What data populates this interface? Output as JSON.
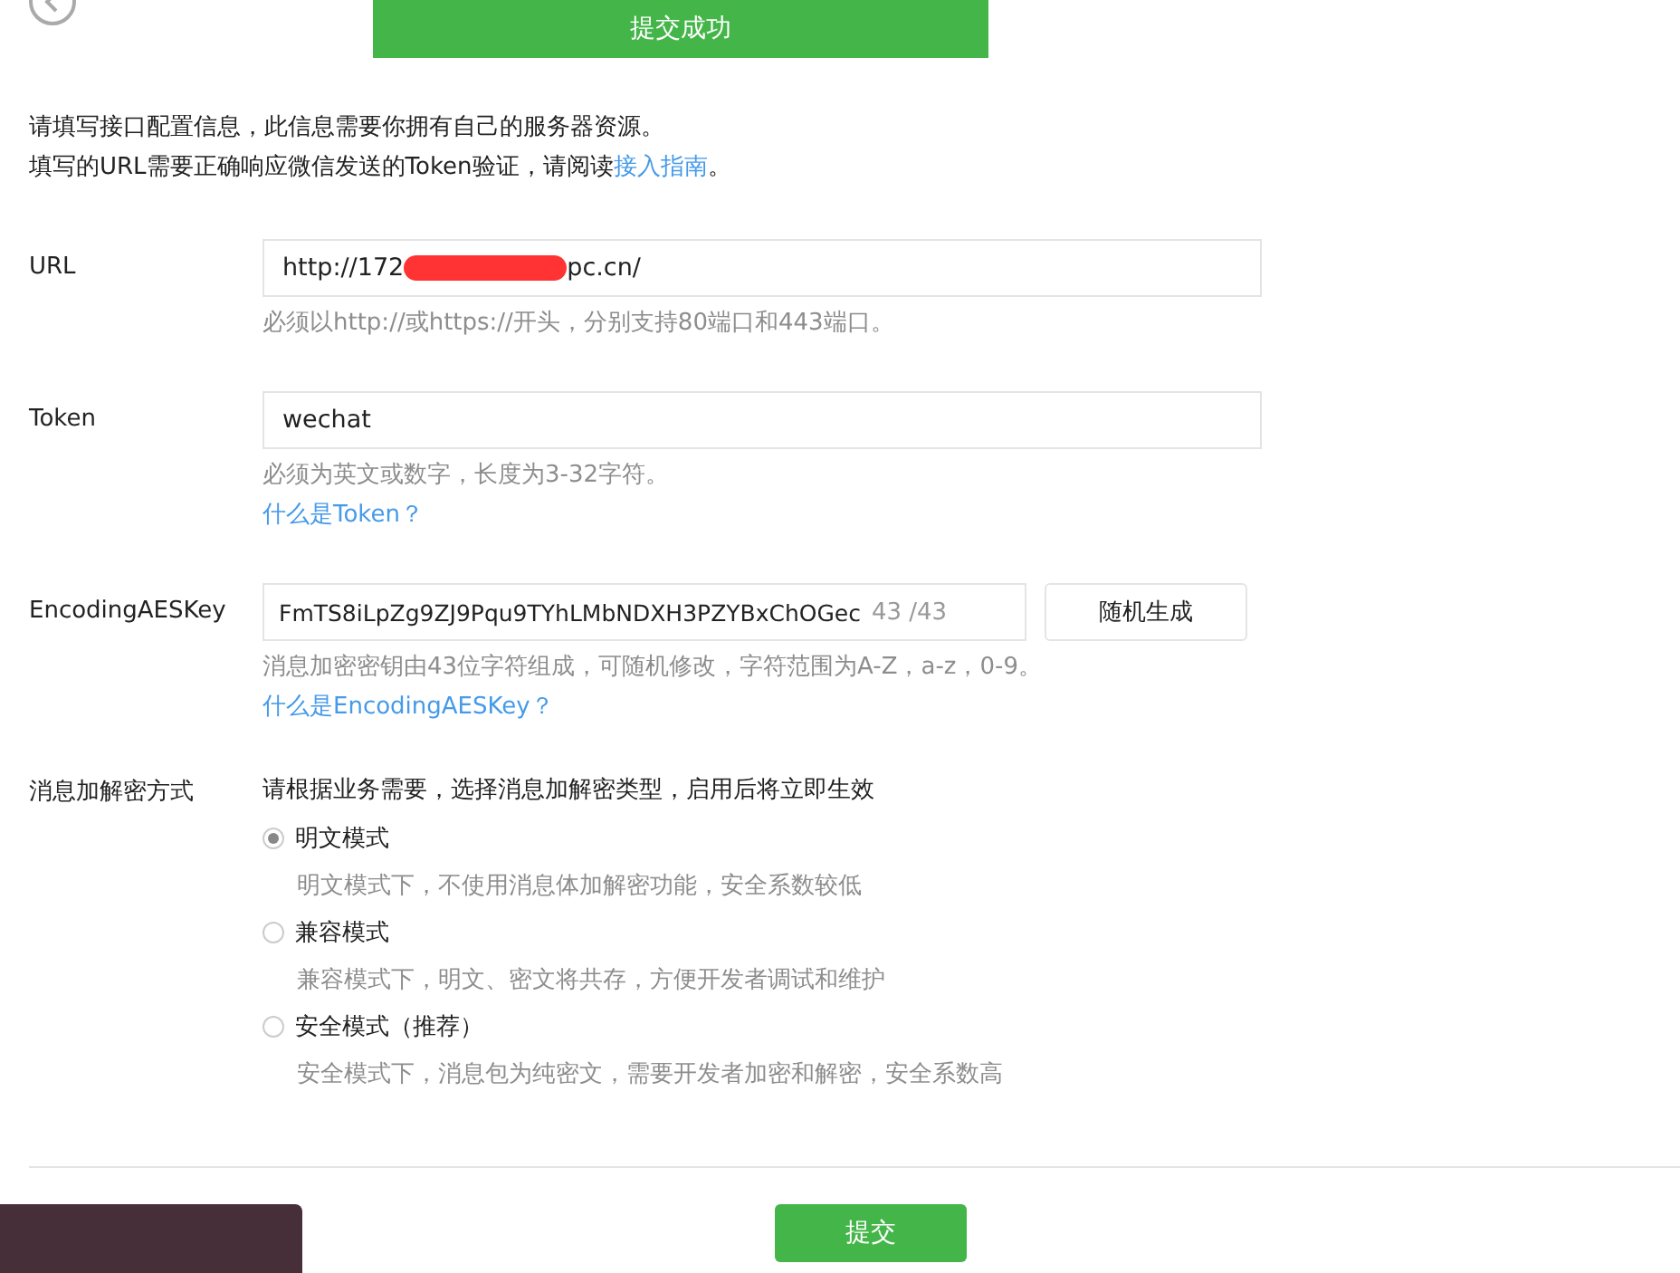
{
  "toast": {
    "message": "提交成功"
  },
  "intro": {
    "line1": "请填写接口配置信息，此信息需要你拥有自己的服务器资源。",
    "line2_before": "填写的URL需要正确响应微信发送的Token验证，请阅读",
    "line2_link": "接入指南",
    "line2_after": "。"
  },
  "url": {
    "label": "URL",
    "value_start": "http://172",
    "redacted": true,
    "value_end": "pc.cn/",
    "hint": "必须以http://或https://开头，分别支持80端口和443端口。"
  },
  "token": {
    "label": "Token",
    "value": "wechat",
    "hint": "必须为英文或数字，长度为3-32字符。",
    "help_link": "什么是Token？"
  },
  "aes_key": {
    "label": "EncodingAESKey",
    "value": "FmTS8iLpZg9ZJ9Pqu9TYhLMbNDXH3PZYBxChOGec",
    "counter": "43 /43",
    "generate_button": "随机生成",
    "hint": "消息加密密钥由43位字符组成，可随机修改，字符范围为A-Z，a-z，0-9。",
    "help_link": "什么是EncodingAESKey？"
  },
  "encryption": {
    "label": "消息加解密方式",
    "instruction": "请根据业务需要，选择消息加解密类型，启用后将立即生效",
    "options": [
      {
        "label": "明文模式",
        "description": "明文模式下，不使用消息体加解密功能，安全系数较低",
        "selected": true
      },
      {
        "label": "兼容模式",
        "description": "兼容模式下，明文、密文将共存，方便开发者调试和维护",
        "selected": false
      },
      {
        "label": "安全模式（推荐）",
        "description": "安全模式下，消息包为纯密文，需要开发者加密和解密，安全系数高",
        "selected": false
      }
    ]
  },
  "submit_button": "提交"
}
